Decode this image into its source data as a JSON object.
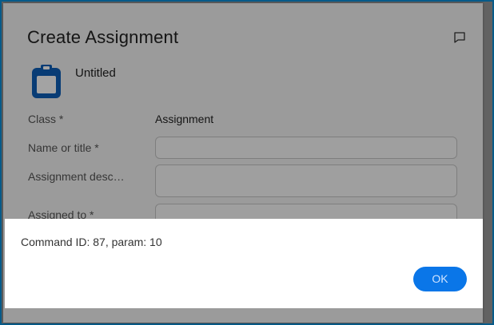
{
  "dialog": {
    "title": "Create Assignment",
    "icons": {
      "comment": "chat-bubble-icon",
      "clipboard": "clipboard-icon"
    },
    "document_name": "Untitled",
    "fields": {
      "class": {
        "label": "Class *",
        "value": "Assignment"
      },
      "name": {
        "label": "Name or title *",
        "value": ""
      },
      "description": {
        "label": "Assignment desc…",
        "value": ""
      },
      "assigned_to": {
        "label": "Assigned to *",
        "value": ""
      }
    }
  },
  "message_box": {
    "text": "Command ID: 87, param: 10",
    "ok_label": "OK"
  },
  "colors": {
    "accent": "#0a76e8",
    "frame": "#0b8fd8",
    "clipboard": "#0d5fb8"
  }
}
